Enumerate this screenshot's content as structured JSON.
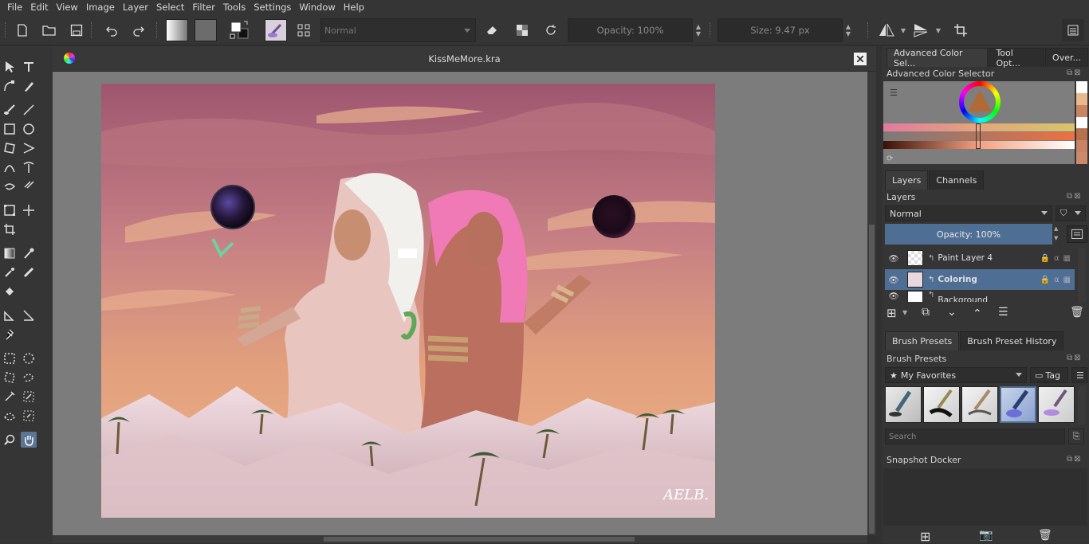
{
  "menu": [
    "File",
    "Edit",
    "View",
    "Image",
    "Layer",
    "Select",
    "Filter",
    "Tools",
    "Settings",
    "Window",
    "Help"
  ],
  "toolbar": {
    "blend_mode": "Normal",
    "opacity": "Opacity: 100%",
    "size": "Size: 9.47 px"
  },
  "document": {
    "title": "KissMeMore.kra",
    "signature": "AELB."
  },
  "dock": {
    "top_tabs": [
      "Advanced Color Sel...",
      "Tool Opt...",
      "Over..."
    ],
    "color_selector_title": "Advanced Color Selector",
    "layer_tabs": [
      "Layers",
      "Channels"
    ],
    "layers_title": "Layers",
    "layer_blend": "Normal",
    "layer_opacity": "Opacity:  100%",
    "layers": [
      {
        "name": "Paint Layer 4",
        "selected": false
      },
      {
        "name": "Coloring",
        "selected": true
      },
      {
        "name": "Background",
        "selected": false
      }
    ],
    "preset_tabs": [
      "Brush Presets",
      "Brush Preset History"
    ],
    "presets_title": "Brush Presets",
    "favorites": "My Favorites",
    "tag": "Tag",
    "search_placeholder": "Search",
    "snapshot_title": "Snapshot Docker"
  },
  "colors": {
    "accent": "#4f6e94",
    "sky_top": "#a05a72",
    "sky_bottom": "#e9a981"
  }
}
